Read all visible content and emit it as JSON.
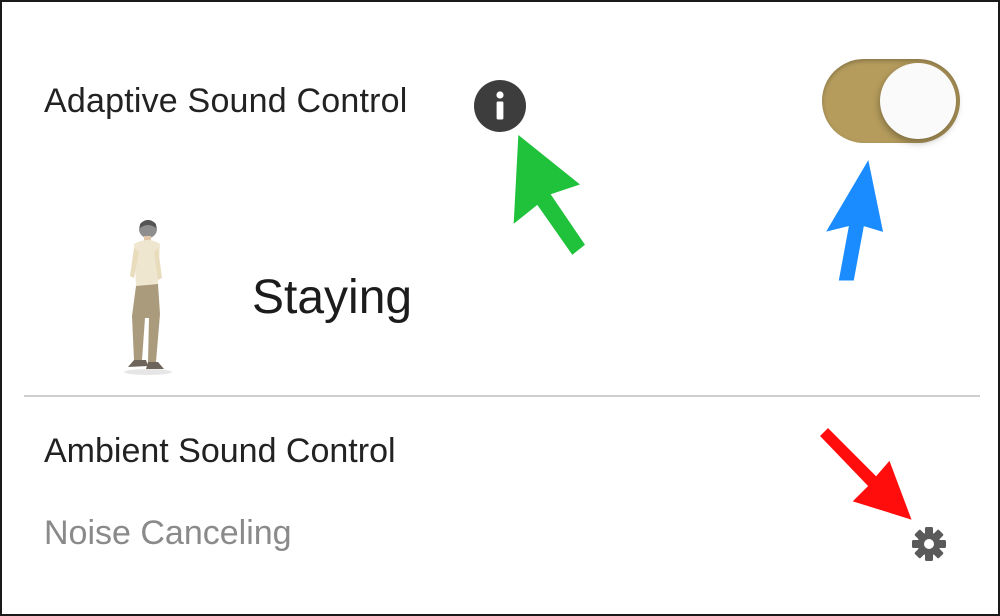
{
  "adaptive": {
    "title": "Adaptive Sound Control",
    "info_icon": "info-icon",
    "toggle_on": true,
    "toggle_color": "#b59c5d",
    "status_label": "Staying",
    "status_icon": "walking-person-icon"
  },
  "ambient": {
    "title": "Ambient Sound Control",
    "mode": "Noise Canceling",
    "settings_icon": "gear-icon"
  },
  "annotations": [
    {
      "icon": "arrow-icon",
      "color": "#1fc23a",
      "target": "info-icon"
    },
    {
      "icon": "arrow-icon",
      "color": "#1a8cff",
      "target": "toggle-switch"
    },
    {
      "icon": "arrow-icon",
      "color": "#ff0d0d",
      "target": "gear-icon"
    }
  ]
}
